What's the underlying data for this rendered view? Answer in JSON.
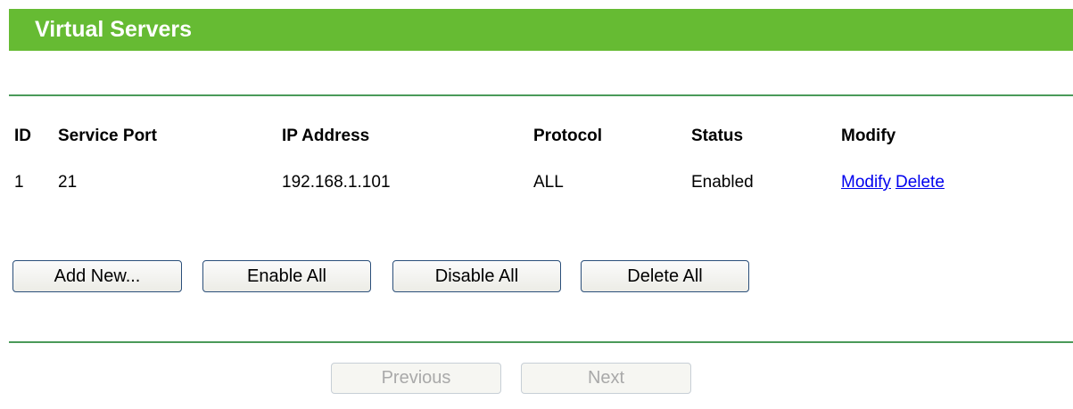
{
  "title": "Virtual Servers",
  "table": {
    "headers": {
      "id": "ID",
      "service_port": "Service Port",
      "ip_address": "IP Address",
      "protocol": "Protocol",
      "status": "Status",
      "modify": "Modify"
    },
    "rows": [
      {
        "id": "1",
        "service_port": "21",
        "ip_address": "192.168.1.101",
        "protocol": "ALL",
        "status": "Enabled",
        "modify_label": "Modify",
        "delete_label": "Delete"
      }
    ]
  },
  "buttons": {
    "add_new": "Add New...",
    "enable_all": "Enable All",
    "disable_all": "Disable All",
    "delete_all": "Delete All"
  },
  "nav": {
    "previous": "Previous",
    "next": "Next"
  },
  "colors": {
    "title_bar": "#66bb33",
    "divider": "#4a9a59",
    "link": "#0000ee"
  }
}
